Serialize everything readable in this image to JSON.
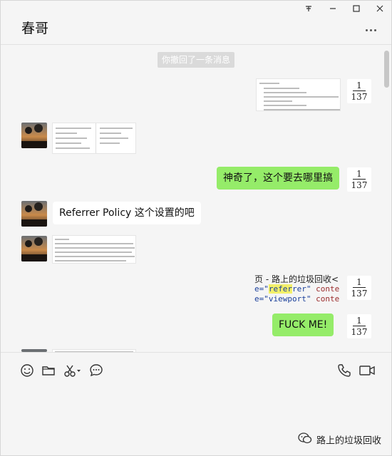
{
  "window": {
    "title": "春哥",
    "controls": {
      "pin": "pin-icon",
      "minimize": "minimize-icon",
      "maximize": "maximize-icon",
      "close": "close-icon"
    },
    "more": "more-dots-icon"
  },
  "messages": {
    "system_notice": "你撤回了一条消息",
    "counters": [
      {
        "num": "1",
        "den": "137"
      },
      {
        "num": "1",
        "den": "137"
      },
      {
        "num": "1",
        "den": "137"
      },
      {
        "num": "1",
        "den": "137"
      }
    ],
    "text_where": "神奇了，这个要去哪里搞",
    "text_referrer": "Referrer Policy 这个设置的吧",
    "text_fuck": "FUCK ME!",
    "code": {
      "line1": "页 - 路上的垃圾回收<",
      "line2_pre": "e=\"",
      "line2_hl": "refer",
      "line2_rest": "rer\"",
      "line2_attr": " conte",
      "line3_pre": "e=\"viewport\"",
      "line3_attr": " conte"
    }
  },
  "toolbar": {
    "emoji": "emoji-icon",
    "file": "folder-icon",
    "screenshot": "scissors-icon",
    "chat_history": "chat-bubble-icon",
    "voice_call": "phone-icon",
    "video_call": "video-camera-icon"
  },
  "watermark": {
    "text": "路上的垃圾回收",
    "logo": "wechat-logo-icon"
  },
  "colors": {
    "green_bubble": "#95ec69",
    "white_bubble": "#ffffff",
    "background": "#f5f5f5"
  }
}
